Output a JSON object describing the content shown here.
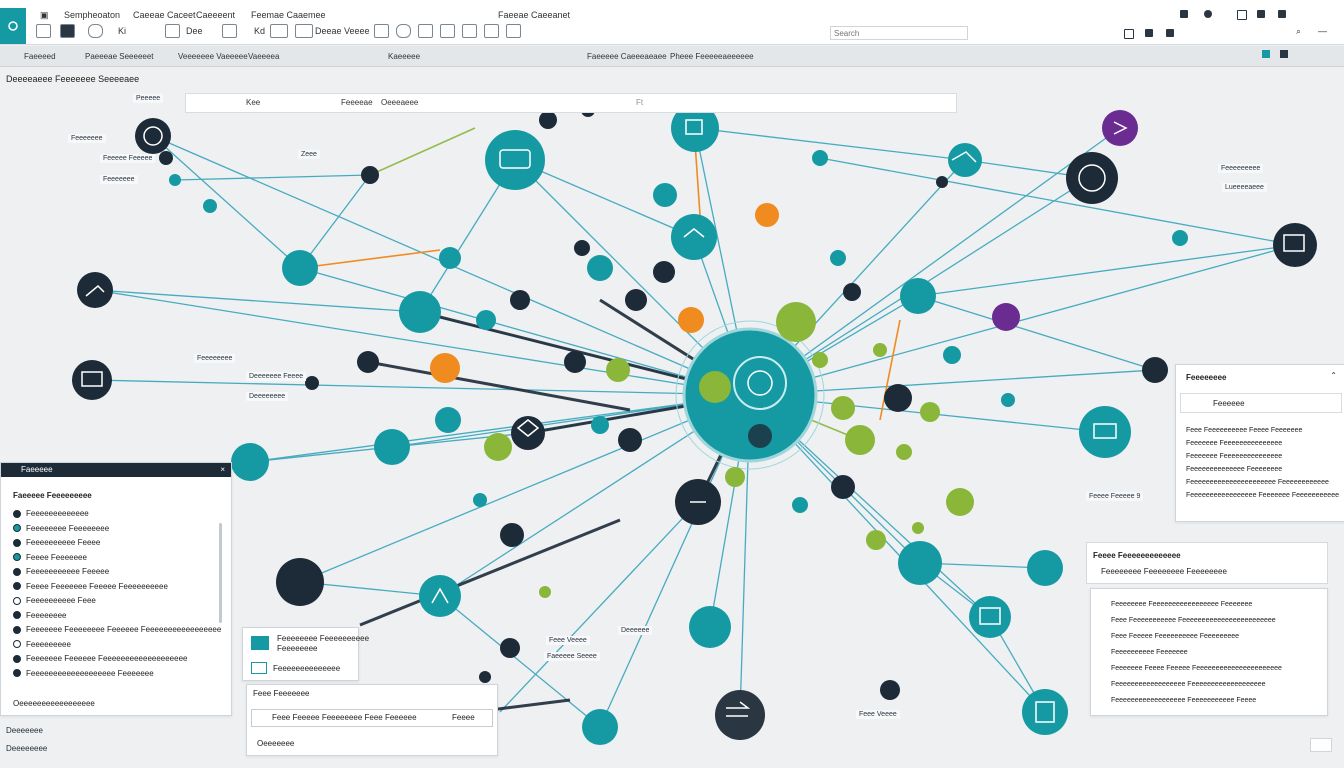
{
  "app": {
    "title": "Sempheoaton",
    "menu": [
      "Sempheoaton",
      "Caeeae Caceet",
      "Caeeeent",
      "Feemae Caaemee"
    ],
    "toolbar_center_title": "Faeeae Caeeanet",
    "toolbar": [
      {
        "label": "Ki",
        "icon": "window-icon"
      },
      {
        "label": "Dee",
        "icon": "image-icon"
      },
      {
        "label": "",
        "icon": "undo-icon"
      },
      {
        "label": "Kd",
        "icon": "cut-icon"
      },
      {
        "label": "",
        "icon": "layers-icon"
      },
      {
        "label": "Kd",
        "icon": "table-icon"
      },
      {
        "label": "Ki",
        "icon": "text-icon"
      },
      {
        "label": "Deeae Veeee",
        "icon": "graph-icon"
      },
      {
        "label": "",
        "icon": "node-icon"
      },
      {
        "label": "",
        "icon": "edge-icon"
      },
      {
        "label": "",
        "icon": "pencil-icon"
      },
      {
        "label": "",
        "icon": "move-icon"
      }
    ],
    "search_placeholder": "Search"
  },
  "subbar": [
    "Faeeeed",
    "Paeeeae Seeeeeet",
    "Veeeeeee Vaeeeee",
    "Vaeeeea",
    "Kaeeeee",
    "Faeeeee Caeeeaeaee",
    "Pheee Feeeeeaeeeeee"
  ],
  "breadcrumb": "Deeeeaeee Feeeeeee Seeeeaee",
  "filter": {
    "label_a": "Kee",
    "label_b": "Feeeeae",
    "label_c": "Oeeeaeee"
  },
  "floating_labels": [
    {
      "text": "Peeeee",
      "name": "node-label-a"
    },
    {
      "text": "Feeeeeee",
      "name": "node-label-b"
    },
    {
      "text": "Feeeee Feeeee",
      "name": "node-label-c"
    },
    {
      "text": "Zeee",
      "name": "node-label-d"
    },
    {
      "text": "Feeeeeee",
      "name": "node-label-e"
    },
    {
      "text": "Deeeeeee Feeee",
      "name": "node-label-f"
    },
    {
      "text": "Deeeeeeee",
      "name": "node-label-g"
    },
    {
      "text": "Feeeeeeee",
      "name": "node-label-h"
    },
    {
      "text": "Feeeeeeeee",
      "name": "node-label-i"
    },
    {
      "text": "Lueeeeaeee",
      "name": "node-label-j"
    },
    {
      "text": "Feee Veeee",
      "name": "node-label-k"
    },
    {
      "text": "Faeeeee Seeee",
      "name": "node-label-l"
    },
    {
      "text": "Feee Veeee",
      "name": "node-label-m"
    },
    {
      "text": "Deeeeee",
      "name": "node-label-n"
    }
  ],
  "left_panel": {
    "header": "Faeeeee",
    "section": "Faeeeee Feeeeeeeee",
    "items": [
      {
        "label": "Feeeeeeeeeeeee",
        "color": "#1d2a38"
      },
      {
        "label": "Feeeeeeee Feeeeeeee",
        "color": "#159aa3"
      },
      {
        "label": "Feeeeeeeeee Feeee",
        "color": "#1d2a38"
      },
      {
        "label": "Feeee Feeeeeee",
        "color": "#159aa3"
      },
      {
        "label": "Feeeeeeeeeee Feeeee",
        "color": "#1d2a38"
      },
      {
        "label": "Feeee Feeeeeee Feeeee Feeeeeeeeee",
        "color": "#1d2a38"
      },
      {
        "label": "Feeeeeeeeee Feee",
        "color": "#ffffff"
      },
      {
        "label": "Feeeeeeee",
        "color": "#1d2a38"
      },
      {
        "label": "Feeeeeee Feeeeeeee Feeeeee Feeeeeeeeeeeeeeeee",
        "color": "#1d2a38"
      },
      {
        "label": "Feeeeeeeee",
        "color": "#ffffff"
      },
      {
        "label": "Feeeeeee Feeeeee Feeeeeeeeeeeeeeeeeee",
        "color": "#1d2a38"
      },
      {
        "label": "Feeeeeeeeeeeeeeeeeee Feeeeeee",
        "color": "#1d2a38"
      }
    ],
    "footer": "Oeeeeeeeeeeeeeeeee"
  },
  "bottom_left": {
    "title": "Deeeeeee",
    "subtitle": "Deeeeeeee"
  },
  "mini_card": {
    "title": "Feeeeeeee Feeeeeeeeee",
    "sub": "Feeeeeeee",
    "line2": "Feeeeeeeeeeeeee"
  },
  "bottom_center": {
    "title": "Feee Feeeeeee",
    "input_text": "Feee Feeeee Feeeeeeee Feee Feeeeee",
    "btn": "Feeee",
    "footer": "Oeeeeeee"
  },
  "right_panel_top": {
    "header": "Feeeeeeee",
    "sub": "Feeeeee",
    "rows": [
      "Feee Feeeeeeeeee Feeee Feeeeeee",
      "Feeeeeee Feeeeeeeeeeeeeee",
      "Feeeeeee Feeeeeeeeeeeeeee",
      "Feeeeeeeeeeeeee Feeeeeeee",
      "Feeeeeeeeeeeeeeeeeeeeee Feeeeeeeeeeee",
      "Feeeeeeeeeeeeeeeee Feeeeeee Feeeeeeeeeee"
    ],
    "badge": "Feeee Feeeee 9"
  },
  "right_panel_bottom": {
    "header": "Feeee Feeeeeeeeeeeee",
    "sub": "Feeeeeeee Feeeeeeee Feeeeeeee",
    "rows": [
      "Feeeeeeee Feeeeeeeeeeeeeeeee Feeeeeee",
      "Feee Feeeeeeeeeee Feeeeeeeeeeeeeeeeeeeeeeee",
      "Feee Feeeee Feeeeeeeeee Feeeeeeeee",
      "Feeeeeeeeee Feeeeeee",
      "Feeeeeee Feeee Feeeee Feeeeeeeeeeeeeeeeeeeeee",
      "Feeeeeeeeeeeeeeeeee Feeeeeeeeeeeeeeeeeee",
      "Feeeeeeeeeeeeeeeeee Feeeeeeeeeee Feeee"
    ]
  },
  "center_tag": "Faeeeee Seee",
  "zoom_label": "Ft",
  "colors": {
    "teal": "#159aa3",
    "navy": "#1d2a38",
    "lime": "#8ab63a",
    "orange": "#f08b1f",
    "purple": "#6a2c91",
    "line": "#2aa0b8"
  }
}
